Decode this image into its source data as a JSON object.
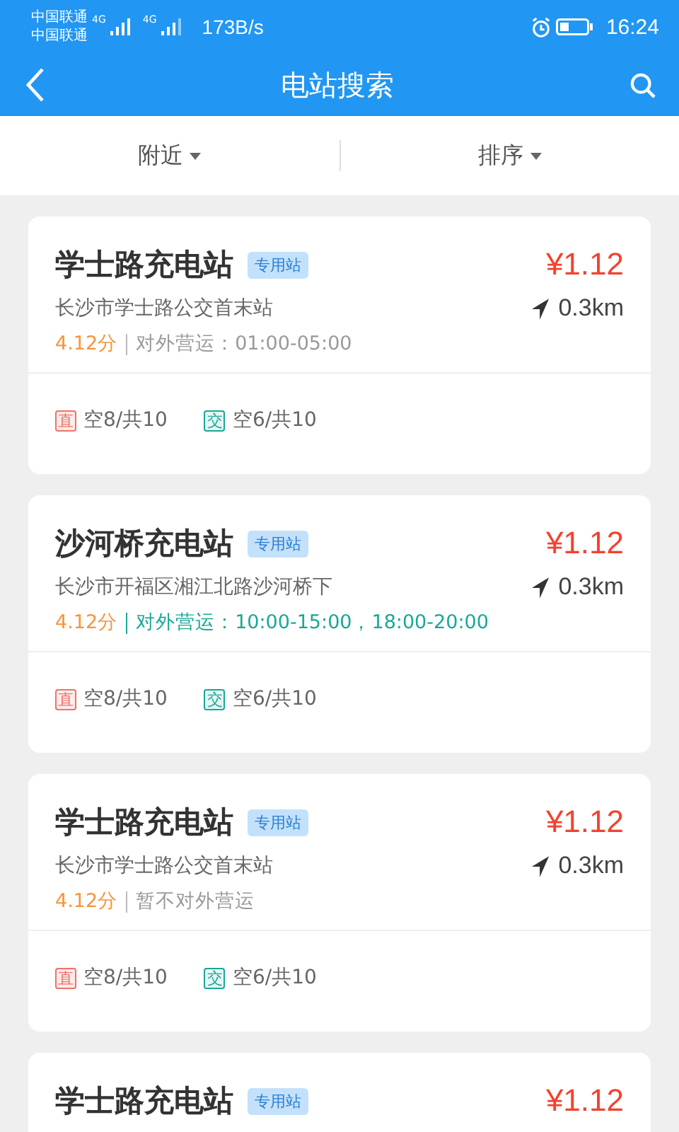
{
  "status_bar": {
    "carrier_1": "中国联通",
    "carrier_2": "中国联通",
    "network_1": "4G",
    "network_2": "4G",
    "speed": "173B/s",
    "time": "16:24"
  },
  "header": {
    "title": "电站搜索"
  },
  "filters": [
    {
      "label": "附近"
    },
    {
      "label": "排序"
    }
  ],
  "stations": [
    {
      "name": "学士路充电站",
      "tag": "专用站",
      "price": "¥1.12",
      "address": "长沙市学士路公交首末站",
      "distance": "0.3km",
      "score": "4.12分",
      "hours": "对外营运：01:00-05:00",
      "open_now": false,
      "chargers": [
        {
          "type": "直",
          "kind": "dc",
          "count": "空8/共10"
        },
        {
          "type": "交",
          "kind": "ac",
          "count": "空6/共10"
        }
      ]
    },
    {
      "name": "沙河桥充电站",
      "tag": "专用站",
      "price": "¥1.12",
      "address": "长沙市开福区湘江北路沙河桥下",
      "distance": "0.3km",
      "score": "4.12分",
      "hours": "对外营运：10:00-15:00，18:00-20:00",
      "open_now": true,
      "chargers": [
        {
          "type": "直",
          "kind": "dc",
          "count": "空8/共10"
        },
        {
          "type": "交",
          "kind": "ac",
          "count": "空6/共10"
        }
      ]
    },
    {
      "name": "学士路充电站",
      "tag": "专用站",
      "price": "¥1.12",
      "address": "长沙市学士路公交首末站",
      "distance": "0.3km",
      "score": "4.12分",
      "hours": "暂不对外营运",
      "open_now": false,
      "chargers": [
        {
          "type": "直",
          "kind": "dc",
          "count": "空8/共10"
        },
        {
          "type": "交",
          "kind": "ac",
          "count": "空6/共10"
        }
      ]
    },
    {
      "name": "学士路充电站",
      "tag": "专用站",
      "price": "¥1.12"
    }
  ]
}
